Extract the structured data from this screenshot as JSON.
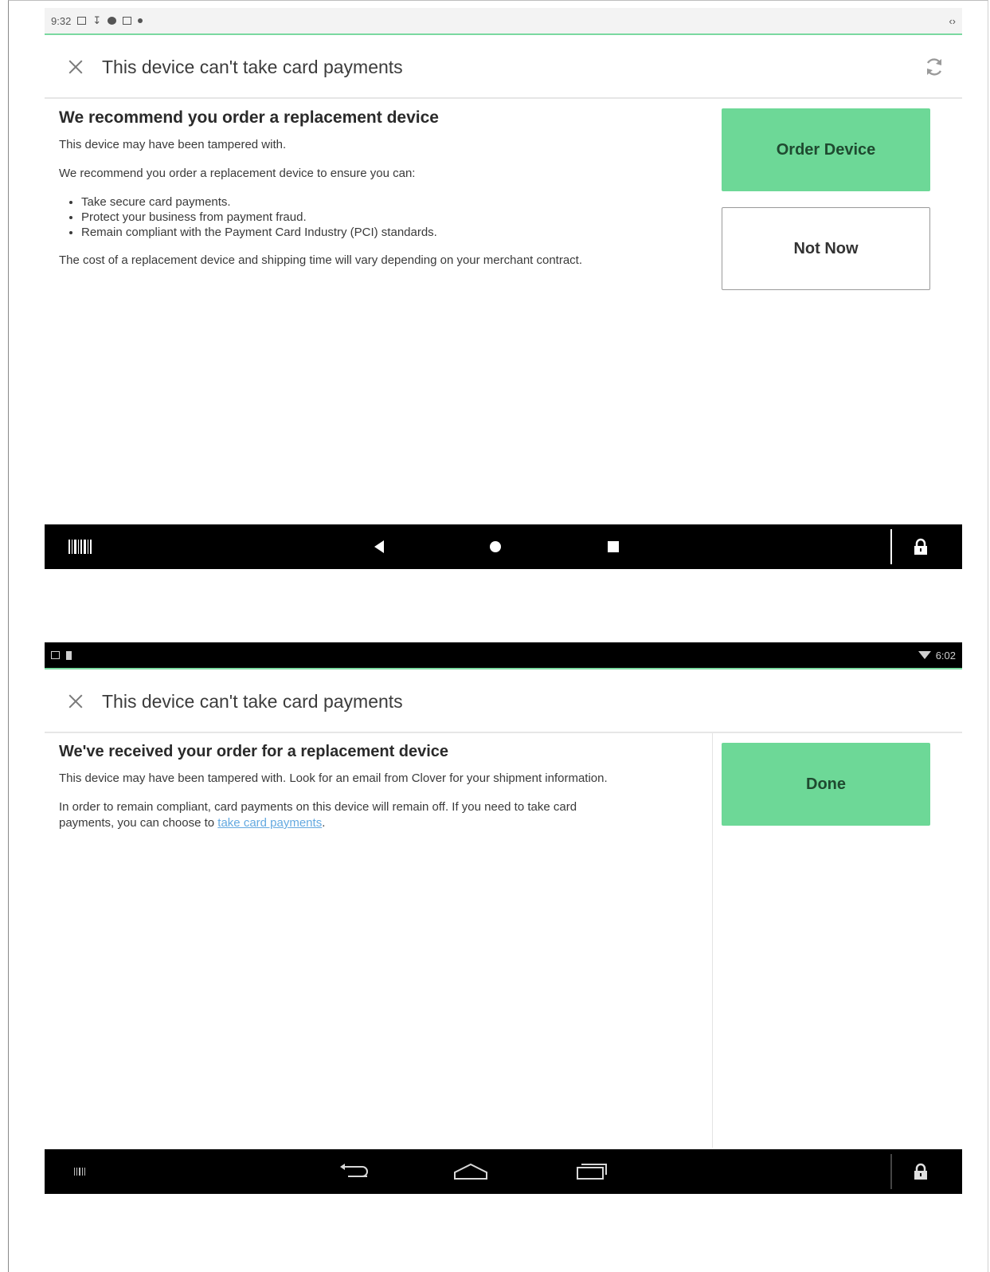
{
  "screen1": {
    "status_bar": {
      "time": "9:32",
      "right_text": "‹›"
    },
    "header": {
      "title": "This device can't take card payments"
    },
    "content": {
      "heading": "We recommend you order a replacement device",
      "para1": "This device may have been tampered with.",
      "para2": "We recommend you order a replacement device to ensure you can:",
      "bullets": [
        "Take secure card payments.",
        "Protect your business from payment fraud.",
        "Remain compliant with the Payment Card Industry (PCI) standards."
      ],
      "para3": "The cost of a replacement device and shipping time will vary depending on your merchant contract."
    },
    "buttons": {
      "primary": "Order Device",
      "secondary": "Not Now"
    },
    "nav_bar": {
      "style": "solid"
    }
  },
  "screen2": {
    "status_bar": {
      "time": "6:02"
    },
    "header": {
      "title": "This device can't take card payments"
    },
    "content": {
      "heading": "We've received your order for a replacement device",
      "para1": "This device may have been tampered with. Look for an email from Clover for your shipment information.",
      "para2_prefix": "In order to remain compliant, card payments on this device will remain off. If you need to take card payments, you can choose to ",
      "para2_link": "take card payments",
      "para2_suffix": "."
    },
    "buttons": {
      "primary": "Done"
    },
    "nav_bar": {
      "style": "outline"
    }
  },
  "colors": {
    "accent_green": "#6dd897",
    "status_green_line": "#7ad9a0",
    "link_blue": "#64a9e0"
  }
}
